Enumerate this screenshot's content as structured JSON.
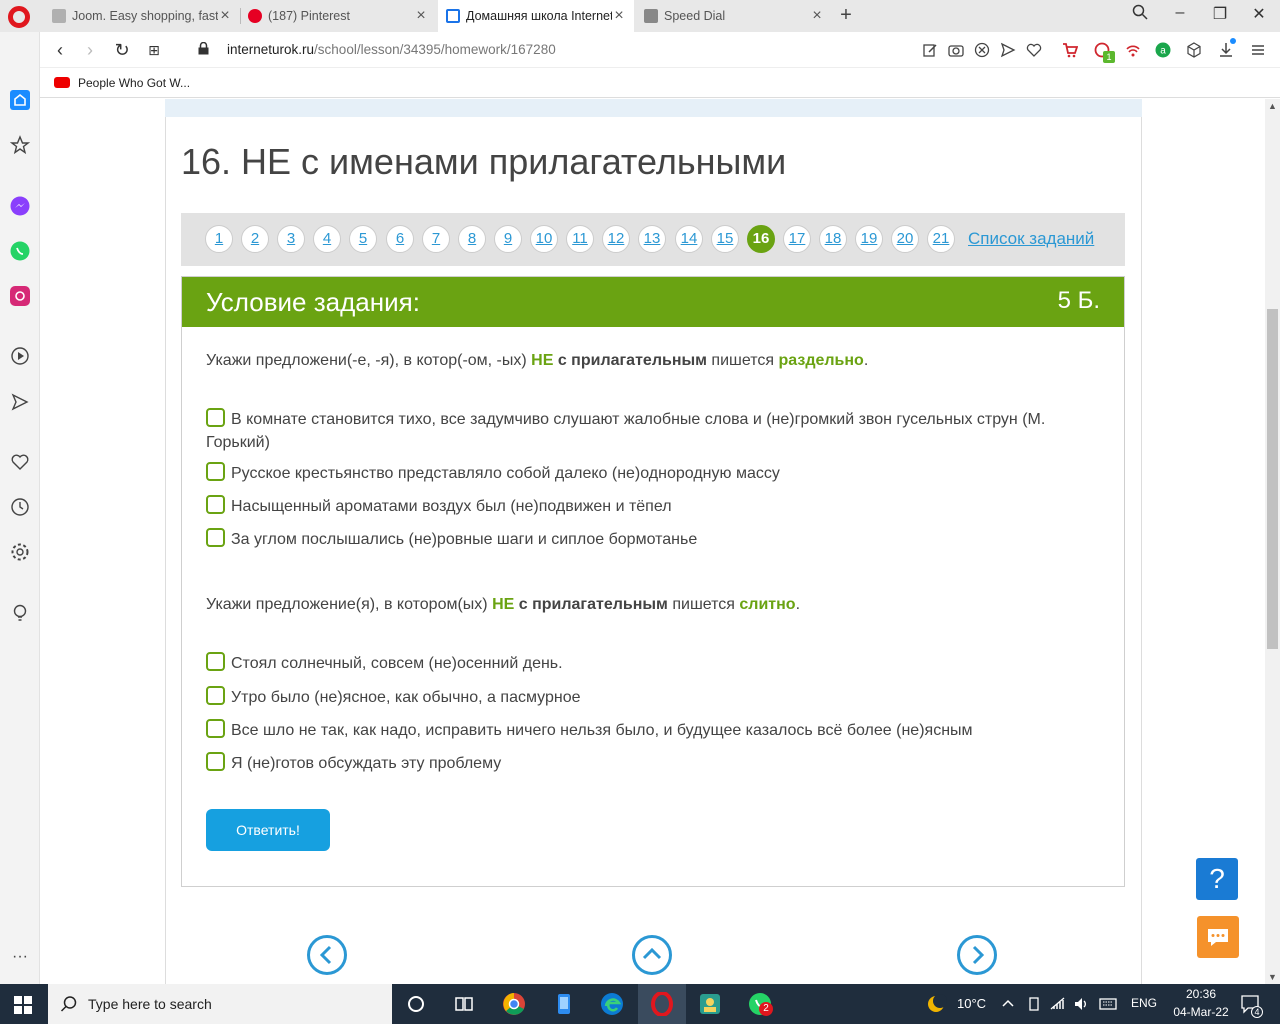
{
  "browser": {
    "tabs": [
      {
        "title": "Joom. Easy shopping, fast a",
        "favicon_color": "#b0b0b0"
      },
      {
        "title": "(187) Pinterest",
        "favicon_color": "#e60023"
      },
      {
        "title": "Домашняя школа Internet",
        "favicon_color": "#1a73e8"
      },
      {
        "title": "Speed Dial",
        "favicon_color": "#666666"
      }
    ],
    "url_host": "interneturok.ru",
    "url_path": "/school/lesson/34395/homework/167280",
    "bookmark": "People Who Got W...",
    "badge_count": "1"
  },
  "page": {
    "lesson_title": "16. НЕ с именами прилагательными",
    "pages": [
      "1",
      "2",
      "3",
      "4",
      "5",
      "6",
      "7",
      "8",
      "9",
      "10",
      "11",
      "12",
      "13",
      "14",
      "15",
      "16",
      "17",
      "18",
      "19",
      "20",
      "21"
    ],
    "current_page": "16",
    "task_list_link": "Список заданий",
    "task_header": "Условие задания:",
    "task_points": "5 Б.",
    "q1": {
      "p1": "Укажи предложени(-е, -я), в котор(-ом, -ых) ",
      "ne": "НЕ",
      "mid": " с прилагательным",
      "p2": " пишется ",
      "key": "раздельно",
      "end": "."
    },
    "q1_options": [
      "В комнате становится тихо, все задумчиво слушают жалобные слова и (не)громкий звон гусельных струн (М. Горький)",
      "Русское крестьянство представляло собой далеко (не)однородную массу",
      "Насыщенный ароматами воздух был (не)подвижен и тёпел",
      "За углом послышались (не)ровные шаги и сиплое бормотанье"
    ],
    "q2": {
      "p1": "Укажи предложение(я), в котором(ых) ",
      "ne": "НЕ",
      "mid": " с прилагательным",
      "p2": " пишется ",
      "key": "слитно",
      "end": "."
    },
    "q2_options": [
      "Стоял солнечный, совсем (не)осенний день.",
      "Утро было (не)ясное, как обычно, а пасмурное",
      "Все шло не так, как надо, исправить ничего нельзя было, и будущее казалось всё более (не)ясным",
      "Я (не)готов обсуждать эту проблему"
    ],
    "answer_button": "Ответить!",
    "help_button": "?"
  },
  "taskbar": {
    "search_placeholder": "Type here to search",
    "temperature": "10°C",
    "language": "ENG",
    "time": "20:36",
    "date": "04-Mar-22",
    "notifications": "4",
    "whatsapp_badge": "2"
  },
  "colors": {
    "accent_green": "#6aa312",
    "link_blue": "#2b98d4",
    "button_blue": "#16a0e0"
  }
}
